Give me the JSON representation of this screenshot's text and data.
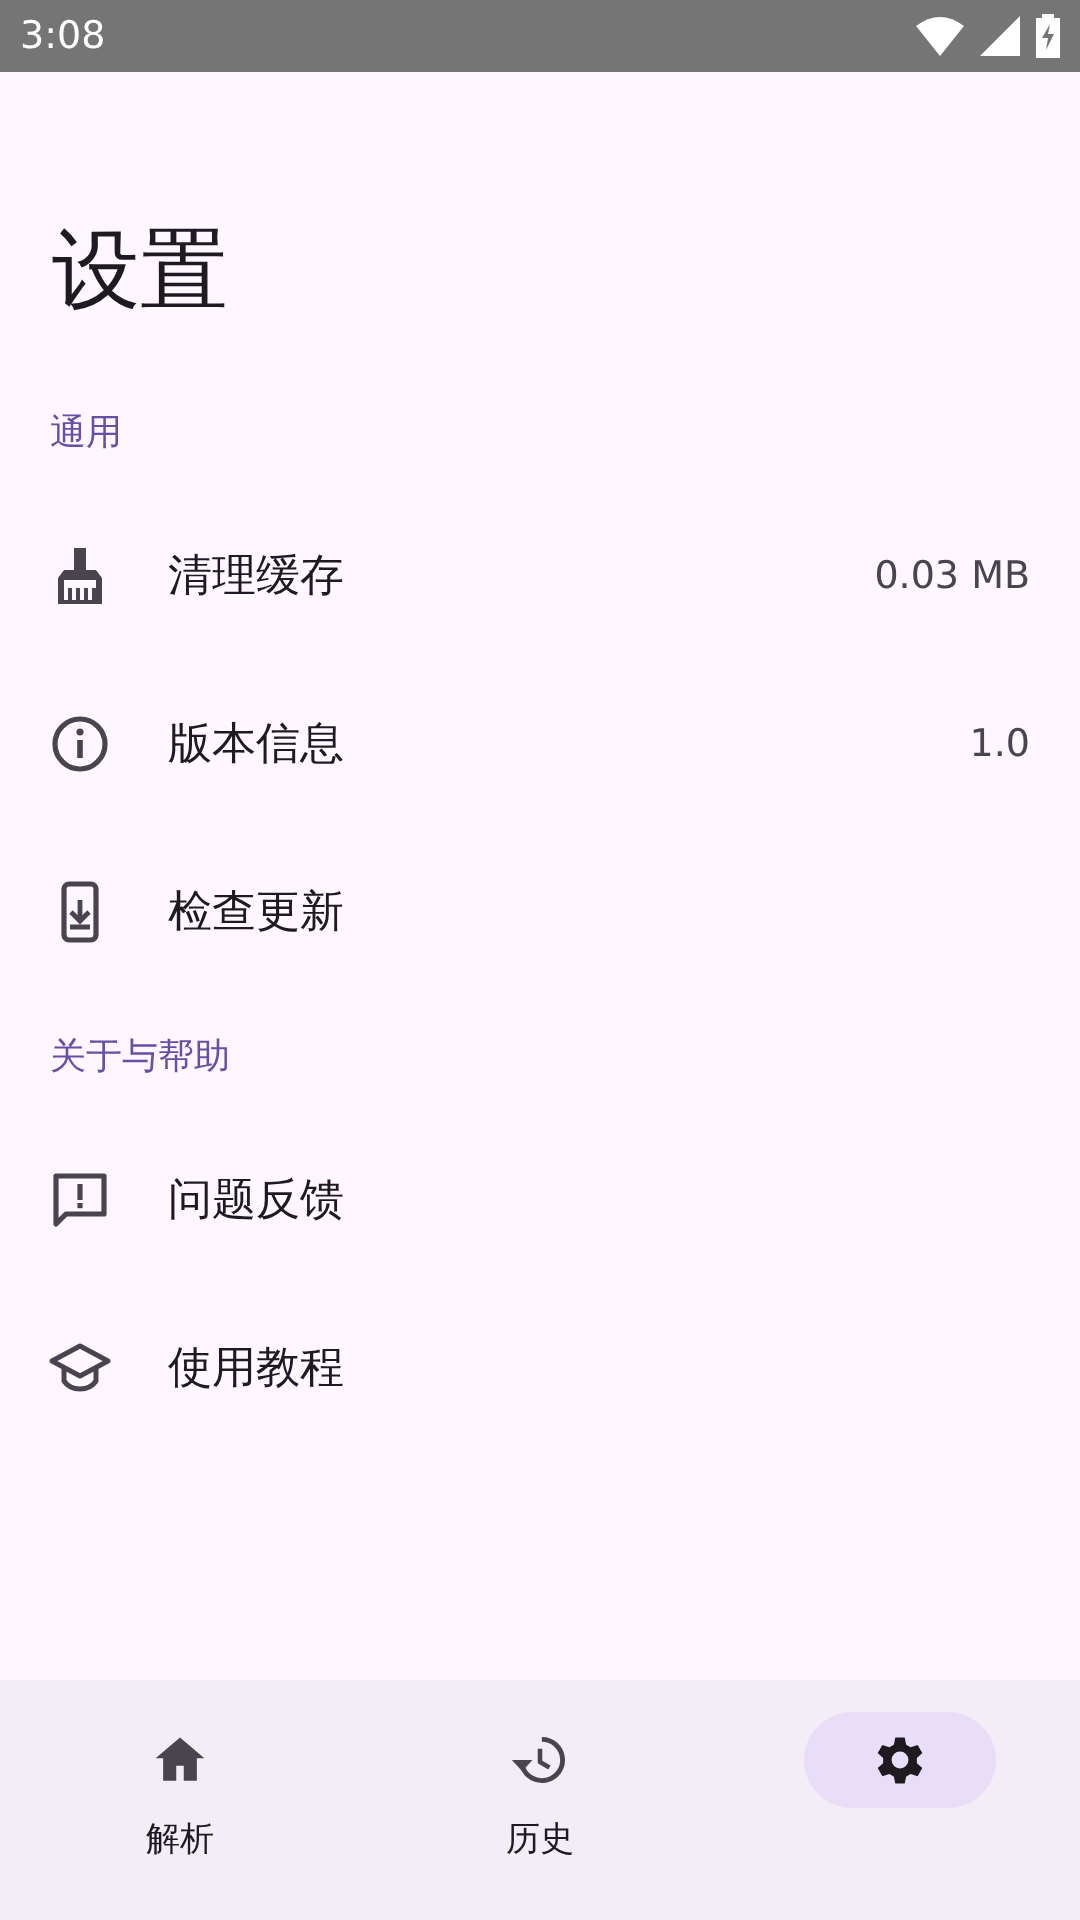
{
  "status_bar": {
    "time": "3:08"
  },
  "title": "设置",
  "sections": [
    {
      "header": "通用",
      "items": [
        {
          "kind": "broom",
          "label": "清理缓存",
          "value": "0.03 MB"
        },
        {
          "kind": "info",
          "label": "版本信息",
          "value": "1.0"
        },
        {
          "kind": "update",
          "label": "检查更新"
        }
      ]
    },
    {
      "header": "关于与帮助",
      "items": [
        {
          "kind": "feedback",
          "label": "问题反馈"
        },
        {
          "kind": "school",
          "label": "使用教程"
        }
      ]
    }
  ],
  "bottom_nav": [
    {
      "kind": "home",
      "label": "解析",
      "selected": false
    },
    {
      "kind": "history",
      "label": "历史",
      "selected": false
    },
    {
      "kind": "settings",
      "selected": true
    }
  ]
}
